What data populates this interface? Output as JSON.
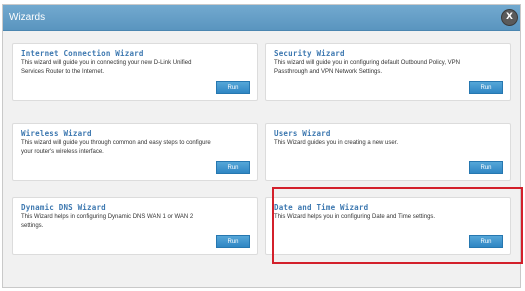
{
  "window": {
    "title": "Wizards",
    "close_label": "X"
  },
  "cards": [
    {
      "title": "Internet Connection Wizard",
      "desc": "This wizard will guide you in connecting your new D-Link Unified Services Router to the Internet.",
      "run": "Run"
    },
    {
      "title": "Security Wizard",
      "desc": "This wizard will guide you in configuring default Outbound Policy, VPN Passthrough and VPN Network Settings.",
      "run": "Run"
    },
    {
      "title": "Wireless Wizard",
      "desc": "This wizard will guide you through common and easy steps to configure your router's wireless interface.",
      "run": "Run"
    },
    {
      "title": "Users Wizard",
      "desc": "This Wizard guides you in creating a new user.",
      "run": "Run"
    },
    {
      "title": "Dynamic DNS Wizard",
      "desc": "This Wizard helps in configuring Dynamic DNS WAN 1 or WAN 2 settings.",
      "run": "Run"
    },
    {
      "title": "Date and Time Wizard",
      "desc": "This Wizard helps you in configuring Date and Time settings.",
      "run": "Run"
    }
  ],
  "highlight_color": "#d3202b"
}
